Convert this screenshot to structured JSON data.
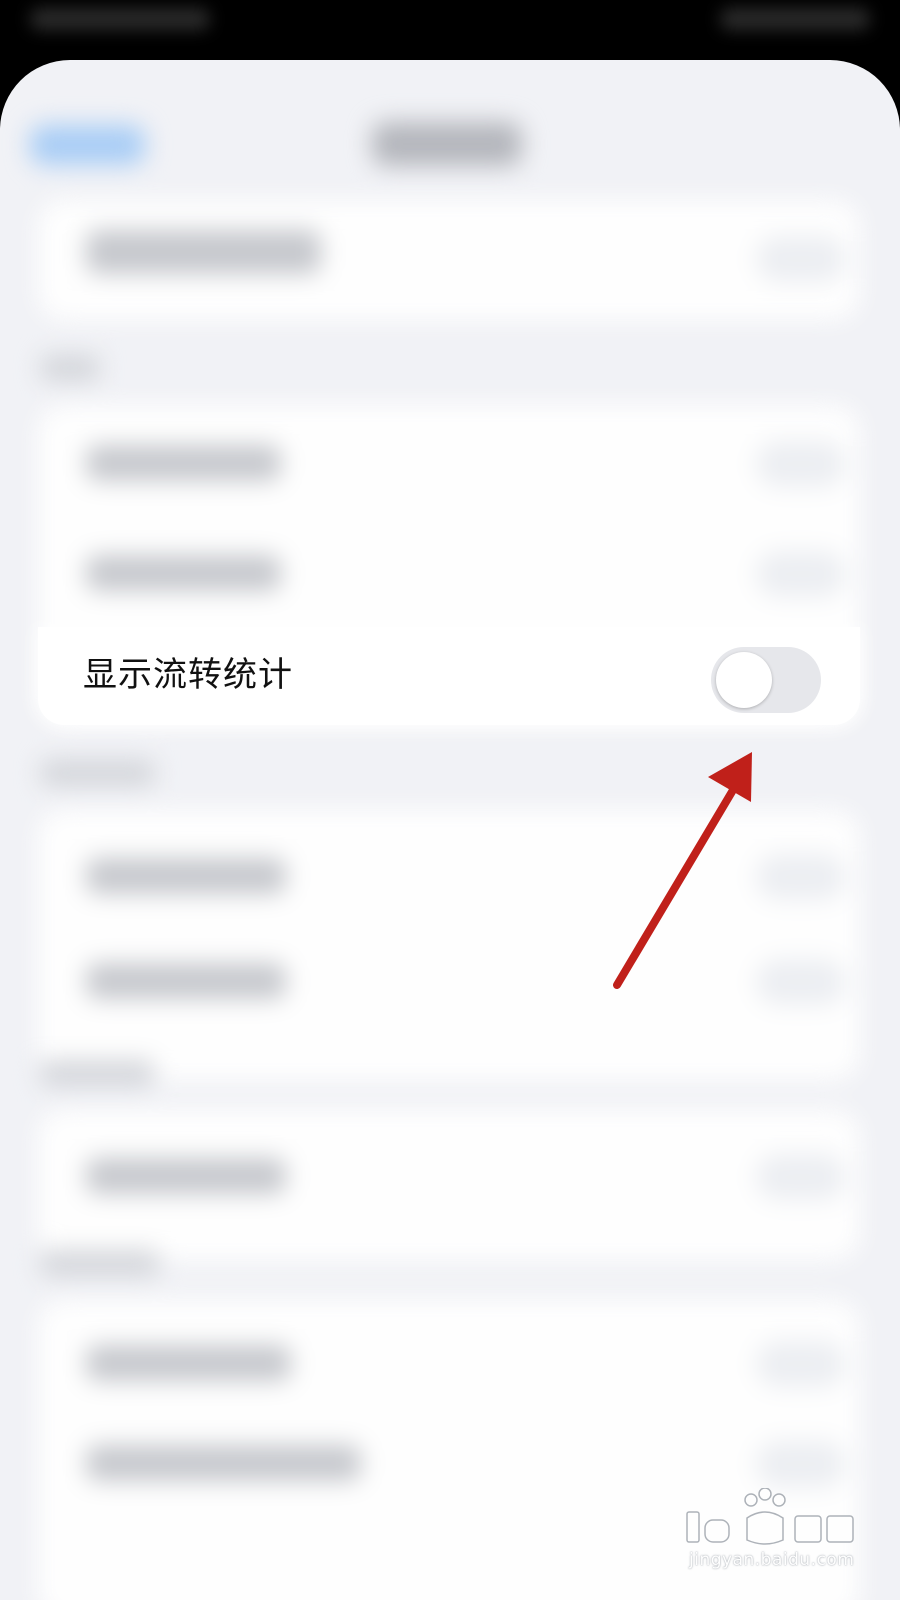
{
  "settings": {
    "show_flow_stats_label": "显示流转统计",
    "show_flow_stats_on": false
  },
  "watermark": {
    "url": "jingyan.baidu.com"
  },
  "colors": {
    "arrow": "#c0201a",
    "toggle_off": "#e6e7eb",
    "sheet_bg": "#f1f2f6"
  },
  "icons": {
    "annotation": "red-arrow-icon",
    "logo": "baidu-jingyan-logo"
  }
}
